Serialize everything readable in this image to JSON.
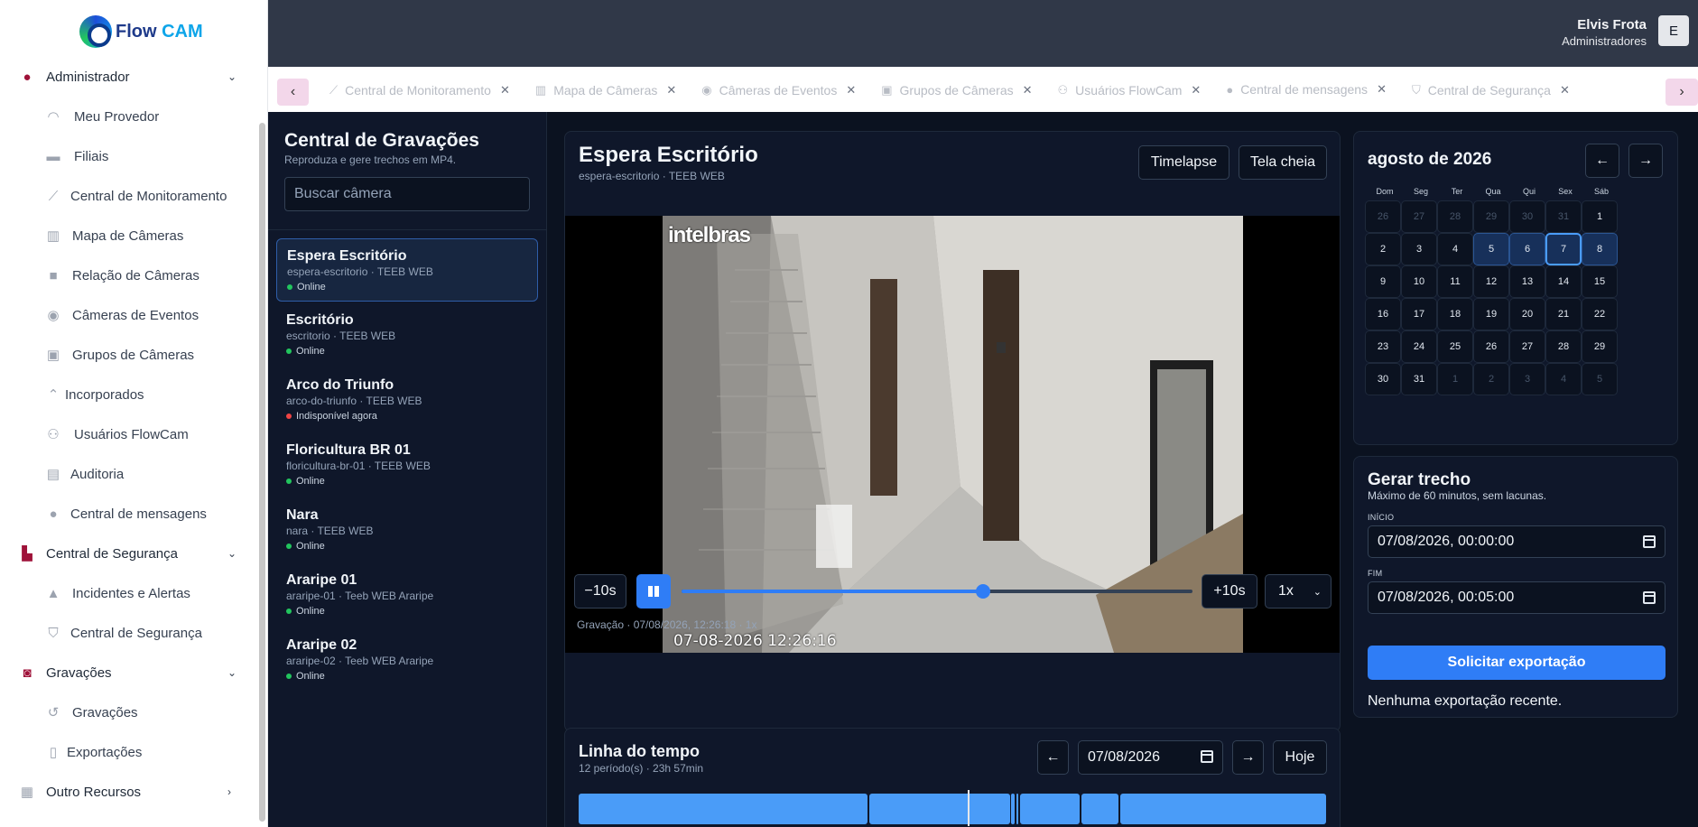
{
  "app": {
    "logo_text": "Flow",
    "logo_accent": "CAM"
  },
  "header": {
    "user_name": "Elvis Frota",
    "user_role": "Administradores",
    "avatar_initial": "E"
  },
  "sidebar": {
    "groups": [
      {
        "label": "Administrador",
        "icon": "user-circle-icon",
        "expanded": true
      },
      {
        "label": "Central de Segurança",
        "icon": "building-icon",
        "expanded": true
      },
      {
        "label": "Gravações",
        "icon": "camera-icon",
        "expanded": true
      },
      {
        "label": "Outro Recursos",
        "icon": "grid-icon",
        "expanded": false
      }
    ],
    "items": [
      {
        "label": "Meu Provedor",
        "icon": "wifi-icon"
      },
      {
        "label": "Filiais",
        "icon": "store-icon"
      },
      {
        "label": "Central de Monitoramento",
        "icon": "chart-line-icon"
      },
      {
        "label": "Mapa de Câmeras",
        "icon": "map-icon"
      },
      {
        "label": "Relação de Câmeras",
        "icon": "video-icon"
      },
      {
        "label": "Câmeras de Eventos",
        "icon": "eye-icon"
      },
      {
        "label": "Grupos de Câmeras",
        "icon": "object-group-icon"
      },
      {
        "label": "Incorporados",
        "icon": "chevrons-up-icon"
      },
      {
        "label": "Usuários FlowCam",
        "icon": "users-icon"
      },
      {
        "label": "Auditoria",
        "icon": "archive-icon"
      },
      {
        "label": "Central de mensagens",
        "icon": "chat-icon"
      },
      {
        "label": "Incidentes e Alertas",
        "icon": "warning-icon"
      },
      {
        "label": "Central de Segurança",
        "icon": "shield-icon"
      },
      {
        "label": "Gravações",
        "icon": "history-icon"
      },
      {
        "label": "Exportações",
        "icon": "file-icon"
      }
    ]
  },
  "tabs": [
    {
      "label": "Central de Monitoramento",
      "icon": "chart-line-icon"
    },
    {
      "label": "Mapa de Câmeras",
      "icon": "map-icon"
    },
    {
      "label": "Câmeras de Eventos",
      "icon": "eye-icon"
    },
    {
      "label": "Grupos de Câmeras",
      "icon": "object-group-icon"
    },
    {
      "label": "Usuários FlowCam",
      "icon": "users-icon"
    },
    {
      "label": "Central de mensagens",
      "icon": "chat-icon"
    },
    {
      "label": "Central de Segurança",
      "icon": "shield-icon"
    }
  ],
  "recordings": {
    "title": "Central de Gravações",
    "subtitle": "Reproduza e gere trechos em MP4.",
    "search_placeholder": "Buscar câmera",
    "cameras": [
      {
        "name": "Espera Escritório",
        "slug": "espera-escritorio · TEEB WEB",
        "status": "Online",
        "online": true
      },
      {
        "name": "Escritório",
        "slug": "escritorio · TEEB WEB",
        "status": "Online",
        "online": true
      },
      {
        "name": "Arco do Triunfo",
        "slug": "arco-do-triunfo · TEEB WEB",
        "status": "Indisponível agora",
        "online": false
      },
      {
        "name": "Floricultura BR 01",
        "slug": "floricultura-br-01 · TEEB WEB",
        "status": "Online",
        "online": true
      },
      {
        "name": "Nara",
        "slug": "nara · TEEB WEB",
        "status": "Online",
        "online": true
      },
      {
        "name": "Araripe 01",
        "slug": "araripe-01 · Teeb WEB Araripe",
        "status": "Online",
        "online": true
      },
      {
        "name": "Araripe 02",
        "slug": "araripe-02 · Teeb WEB Araripe",
        "status": "Online",
        "online": true
      }
    ]
  },
  "player": {
    "title": "Espera Escritório",
    "subtitle": "espera-escritorio · TEEB WEB",
    "timelapse_label": "Timelapse",
    "fullscreen_label": "Tela cheia",
    "osd_logo": "intelbras",
    "osd_timestamp": "07-08-2026 12:26:16",
    "back_label": "−10s",
    "forward_label": "+10s",
    "speed": "1x",
    "progress": 0.59,
    "info": "Gravação · 07/08/2026, 12:26:18 · 1x"
  },
  "timeline": {
    "title": "Linha do tempo",
    "subtitle": "12 período(s) · 23h 57min",
    "date": "07/08/2026",
    "today_label": "Hoje",
    "segments": [
      [
        0.0,
        0.387
      ],
      [
        0.389,
        0.577
      ],
      [
        0.579,
        0.583
      ],
      [
        0.586,
        0.588
      ],
      [
        0.591,
        0.67
      ],
      [
        0.673,
        0.722
      ],
      [
        0.725,
        1.0
      ]
    ],
    "playhead": 0.52
  },
  "calendar": {
    "month_label": "agosto de 2026",
    "weekdays": [
      "Dom",
      "Seg",
      "Ter",
      "Qua",
      "Qui",
      "Sex",
      "Sáb"
    ],
    "weeks": [
      [
        26,
        27,
        28,
        29,
        30,
        31,
        1
      ],
      [
        2,
        3,
        4,
        5,
        6,
        7,
        8
      ],
      [
        9,
        10,
        11,
        12,
        13,
        14,
        15
      ],
      [
        16,
        17,
        18,
        19,
        20,
        21,
        22
      ],
      [
        23,
        24,
        25,
        26,
        27,
        28,
        29
      ],
      [
        30,
        31,
        1,
        2,
        3,
        4,
        5
      ]
    ],
    "with_recordings": [
      5,
      6,
      7,
      8
    ],
    "selected": 7
  },
  "export": {
    "title": "Gerar trecho",
    "subtitle": "Máximo de 60 minutos, sem lacunas.",
    "start_label": "INÍCIO",
    "start_value": "07/08/2026, 00:00:00",
    "end_label": "FIM",
    "end_value": "07/08/2026, 00:05:00",
    "button_label": "Solicitar exportação",
    "empty_text": "Nenhuma exportação recente."
  }
}
